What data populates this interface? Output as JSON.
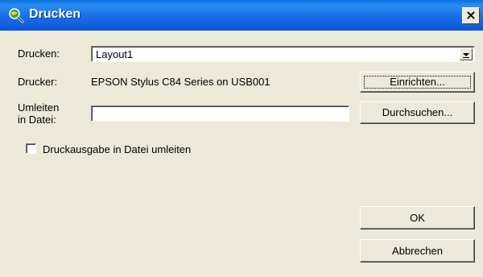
{
  "window": {
    "title": "Drucken",
    "close_glyph": "×"
  },
  "form": {
    "print_label": "Drucken:",
    "print_value": "Layout1",
    "printer_label": "Drucker:",
    "printer_value": "EPSON Stylus C84 Series on USB001",
    "redirect_label_line1": "Umleiten",
    "redirect_label_line2": "in Datei:",
    "redirect_value": "",
    "redirect_checkbox_label": "Druckausgabe in Datei umleiten",
    "redirect_checkbox_checked": false
  },
  "buttons": {
    "setup": "Einrichten...",
    "browse": "Durchsuchen...",
    "ok": "OK",
    "cancel": "Abbrechen"
  },
  "icons": {
    "title_icon": "magnifier-globe-icon",
    "dropdown_arrow": "chevron-down-icon"
  },
  "colors": {
    "titlebar": "#0a58d8",
    "dialog_bg": "#ece9d8"
  }
}
